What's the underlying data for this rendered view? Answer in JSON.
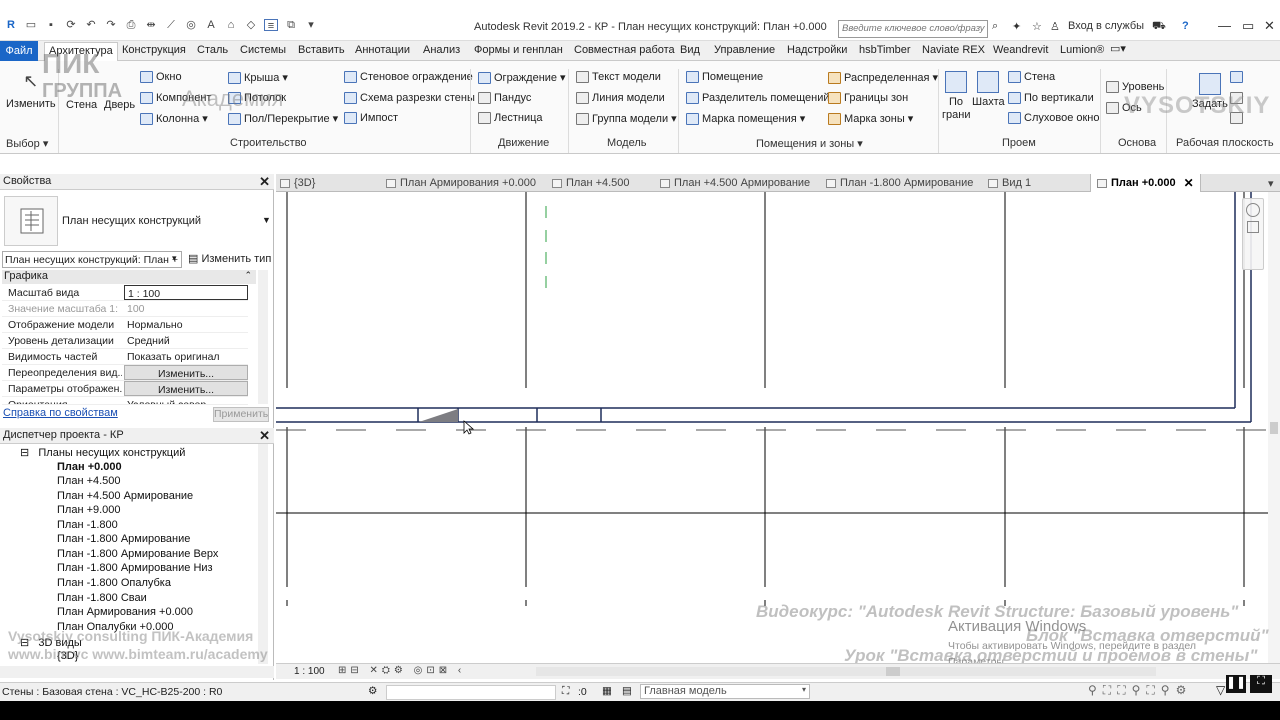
{
  "title_bar": {
    "app_title": "Autodesk Revit 2019.2 - КР - План несущих конструкций: План +0.000",
    "search_placeholder": "Введите ключевое слово/фразу",
    "signin": "Вход в службы",
    "help": "?"
  },
  "ribbon_tabs": [
    "Файл",
    "Архитектура",
    "Конструкция",
    "Сталь",
    "Системы",
    "Вставить",
    "Аннотации",
    "Анализ",
    "Формы и генплан",
    "Совместная работа",
    "Вид",
    "Управление",
    "Надстройки",
    "hsbTimber",
    "Naviate REX",
    "Weandrevit",
    "Lumion®"
  ],
  "ribbon": {
    "select": {
      "modify": "Изменить",
      "group": "Выбор"
    },
    "build": {
      "wall": "Стена",
      "door": "Дверь",
      "window": "Окно",
      "component": "Компонент",
      "column": "Колонна",
      "roof": "Крыша",
      "ceiling": "Потолок",
      "floor": "Пол/Перекрытие",
      "curtain_system": "Стеновое ограждение",
      "curtain_grid": "Схема разрезки стены",
      "mullion": "Импост",
      "group": "Строительство"
    },
    "circulation": {
      "railing": "Ограждение",
      "ramp": "Пандус",
      "stair": "Лестница",
      "group": "Движение"
    },
    "model": {
      "model_text": "Текст модели",
      "model_line": "Линия модели",
      "model_group": "Группа модели",
      "group": "Модель"
    },
    "room": {
      "room": "Помещение",
      "room_sep": "Разделитель помещений",
      "room_tag": "Марка помещения",
      "area": "Распределенная",
      "area_boundary": "Границы зон",
      "area_tag": "Марка зоны",
      "group": "Помещения и зоны"
    },
    "opening": {
      "by_face": "По грани",
      "shaft": "Шахта",
      "wall": "Стена",
      "vertical": "По вертикали",
      "dormer": "Слуховое окно",
      "group": "Проем"
    },
    "datum": {
      "level": "Уровень",
      "grid": "Ось",
      "group": "Основа"
    },
    "workplane": {
      "set": "Задать",
      "group": "Рабочая плоскость"
    }
  },
  "watermarks": {
    "logo_top": "ПИК",
    "logo_bottom": "ГРУППА",
    "logo_academy": "Академия",
    "brand": "VYSOTSKIY",
    "left_line1": "Vysotskiy consulting  ПИК-Академия",
    "left_line2": "www.bim.vc       www.bimteam.ru/academy",
    "right_line1": "Видеокурс: \"Autodesk Revit Structure: Базовый уровень\"",
    "right_line2": "Блок \"Вставка отверстий\"",
    "right_line3": "Урок \"Вставка отверстий и проемов в стены\""
  },
  "properties": {
    "title": "Свойства",
    "type_name": "План несущих конструкций",
    "instance_dropdown": "План несущих конструкций: План +",
    "edit_type": "Изменить тип",
    "category": "Графика",
    "rows": [
      {
        "key": "Масштаб вида",
        "value": "1 : 100"
      },
      {
        "key": "Значение масштаба    1:",
        "value": "100"
      },
      {
        "key": "Отображение модели",
        "value": "Нормально"
      },
      {
        "key": "Уровень детализации",
        "value": "Средний"
      },
      {
        "key": "Видимость частей",
        "value": "Показать оригинал"
      },
      {
        "key": "Переопределения вид...",
        "value": "Изменить..."
      },
      {
        "key": "Параметры отображен...",
        "value": "Изменить..."
      },
      {
        "key": "Ориентация",
        "value": "Условный север"
      }
    ],
    "help_link": "Справка по свойствам",
    "apply": "Применить"
  },
  "project_browser": {
    "title": "Диспетчер проекта - КР",
    "group": "Планы несущих конструкций",
    "items": [
      "План +0.000",
      "План +4.500",
      "План +4.500 Армирование",
      "План +9.000",
      "План -1.800",
      "План -1.800 Армирование",
      "План -1.800 Армирование Верх",
      "План -1.800 Армирование Низ",
      "План -1.800 Опалубка",
      "План -1.800 Сваи",
      "План Армирования +0.000",
      "План Опалубки +0.000"
    ],
    "group2": "3D виды",
    "sub2": "{3D}"
  },
  "view_tabs": [
    "{3D}",
    "План Армирования +0.000",
    "План +4.500",
    "План +4.500 Армирование",
    "План -1.800 Армирование",
    "Вид 1",
    "План +0.000"
  ],
  "view_control": {
    "scale": "1 : 100"
  },
  "activation": {
    "title": "Активация Windows",
    "sub": "Чтобы активировать Windows, перейдите в раздел",
    "sub2": "Параметры"
  },
  "status": {
    "text": "Стены : Базовая стена : VC_HC-B25-200 : R0",
    "count": ":0",
    "model": "Главная модель"
  },
  "colors": {
    "accent": "#1a66c7",
    "wall_line": "#1e2d5a",
    "grid_line": "#000000",
    "green_dash": "#2ea043"
  }
}
